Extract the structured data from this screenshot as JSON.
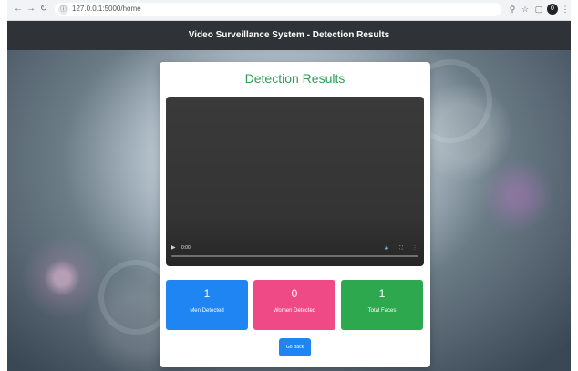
{
  "browser": {
    "url": "127.0.0.1:5000/home",
    "profile_initial": "0"
  },
  "header": {
    "title": "Video Surveillance System - Detection Results"
  },
  "card": {
    "title": "Detection Results",
    "video": {
      "time": "0:00"
    },
    "stats": [
      {
        "value": "1",
        "label": "Men Detected",
        "color": "#1e85f2"
      },
      {
        "value": "0",
        "label": "Women Detected",
        "color": "#f04a86"
      },
      {
        "value": "1",
        "label": "Total Faces",
        "color": "#2ea84f"
      }
    ],
    "back_label": "Go Back"
  },
  "icons": {
    "back": "arrow-left-icon",
    "forward": "arrow-right-icon",
    "reload": "reload-icon",
    "site_info": "site-info-icon",
    "zoom": "zoom-icon",
    "bookmark": "star-icon",
    "extensions": "extensions-icon",
    "menu": "more-vert-icon",
    "play": "play-icon",
    "volume": "volume-icon",
    "fullscreen": "fullscreen-icon",
    "video_menu": "more-vert-icon"
  }
}
